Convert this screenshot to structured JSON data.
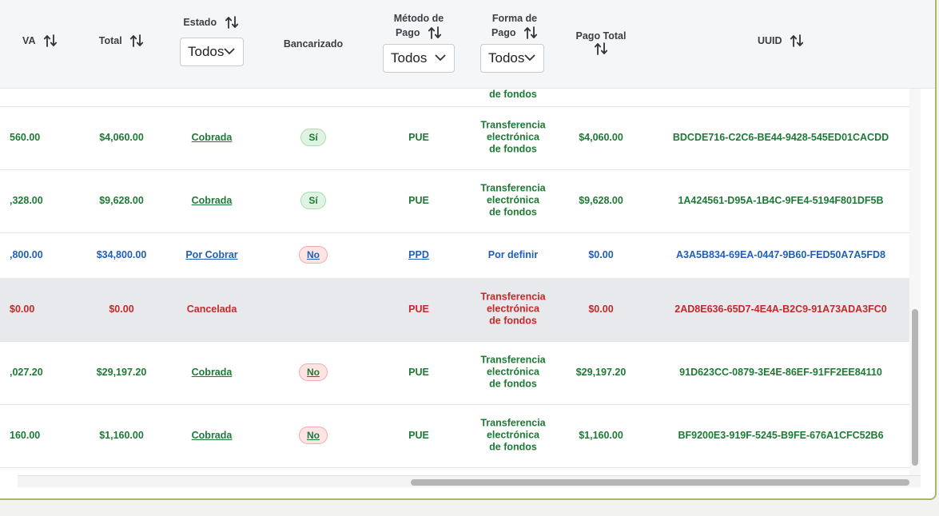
{
  "header": {
    "iva": "VA",
    "total": "Total",
    "estado": "Estado",
    "estado_filter": "Todos",
    "bancarizado": "Bancarizado",
    "metodo_line1": "Método de",
    "metodo_line2": "Pago",
    "metodo_filter": "Todos",
    "forma_line1": "Forma de",
    "forma_line2": "Pago",
    "forma_filter": "Todos",
    "pago_total": "Pago Total",
    "uuid": "UUID"
  },
  "partial_row": {
    "forma": "de fondos"
  },
  "rows": [
    {
      "iva": "560.00",
      "total": "$4,060.00",
      "estado": "Cobrada",
      "bancarizado": "Sí",
      "metodo": "PUE",
      "forma1": "Transferencia",
      "forma2": "electrónica",
      "forma3": "de fondos",
      "pago_total": "$4,060.00",
      "uuid": "BDCDE716-C2C6-BE44-9428-545ED01CACDD"
    },
    {
      "iva": ",328.00",
      "total": "$9,628.00",
      "estado": "Cobrada",
      "bancarizado": "Sí",
      "metodo": "PUE",
      "forma1": "Transferencia",
      "forma2": "electrónica",
      "forma3": "de fondos",
      "pago_total": "$9,628.00",
      "uuid": "1A424561-D95A-1B4C-9FE4-5194F801DF5B"
    },
    {
      "iva": ",800.00",
      "total": "$34,800.00",
      "estado": "Por Cobrar",
      "bancarizado": "No",
      "metodo": "PPD",
      "forma1": "Por definir",
      "pago_total": "$0.00",
      "uuid": "A3A5B834-69EA-0447-9B60-FED50A7A5FD8"
    },
    {
      "iva": "$0.00",
      "total": "$0.00",
      "estado": "Cancelada",
      "bancarizado": "",
      "metodo": "PUE",
      "forma1": "Transferencia",
      "forma2": "electrónica",
      "forma3": "de fondos",
      "pago_total": "$0.00",
      "uuid": "2AD8E636-65D7-4E4A-B2C9-91A73ADA3FC0"
    },
    {
      "iva": ",027.20",
      "total": "$29,197.20",
      "estado": "Cobrada",
      "bancarizado": "No",
      "metodo": "PUE",
      "forma1": "Transferencia",
      "forma2": "electrónica",
      "forma3": "de fondos",
      "pago_total": "$29,197.20",
      "uuid": "91D623CC-0879-3E4E-86EF-91FF2EE84110"
    },
    {
      "iva": "160.00",
      "total": "$1,160.00",
      "estado": "Cobrada",
      "bancarizado": "No",
      "metodo": "PUE",
      "forma1": "Transferencia",
      "forma2": "electrónica",
      "forma3": "de fondos",
      "pago_total": "$1,160.00",
      "uuid": "BF9200E3-919F-5245-B9FE-676A1CFC52B6"
    }
  ],
  "icons": {
    "sort": "sort-arrows-icon",
    "chevron": "chevron-down-icon"
  },
  "colors": {
    "paid": "#1d7a35",
    "pending": "#1f5fb8",
    "cancelled": "#c62828"
  }
}
